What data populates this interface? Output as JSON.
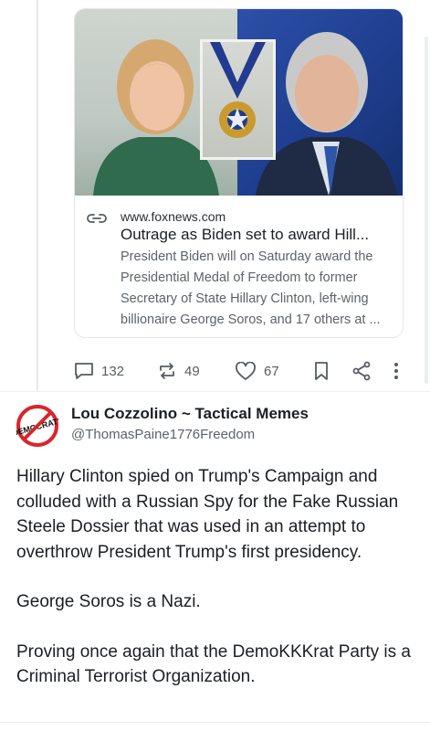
{
  "link_card": {
    "domain": "www.foxnews.com",
    "title": "Outrage as Biden set to award Hill...",
    "description": "President Biden will on Saturday award the Presidential Medal of Freedom to former Secretary of State Hillary Clinton, left-wing billionaire George Soros, and 17 others at ..."
  },
  "actions": {
    "replies": "132",
    "reposts": "49",
    "likes": "67"
  },
  "post": {
    "author_name": "Lou Cozzolino ~ Tactical Memes",
    "author_handle": "@ThomasPaine1776Freedom",
    "avatar_text": "DEMOCRATS",
    "paragraphs": [
      "Hillary Clinton spied on Trump's Campaign and colluded with a Russian Spy for the Fake Russian Steele Dossier that was used in an attempt to overthrow President Trump's first presidency.",
      "George Soros is a Nazi.",
      "Proving once again that the DemoKKKrat Party is a Criminal Terrorist Organization."
    ]
  },
  "colors": {
    "accent_red": "#d9262b",
    "muted_text": "#5d636a"
  },
  "icons": [
    "link-icon",
    "reply-icon",
    "repost-icon",
    "like-icon",
    "bookmark-icon",
    "share-icon",
    "more-icon"
  ]
}
